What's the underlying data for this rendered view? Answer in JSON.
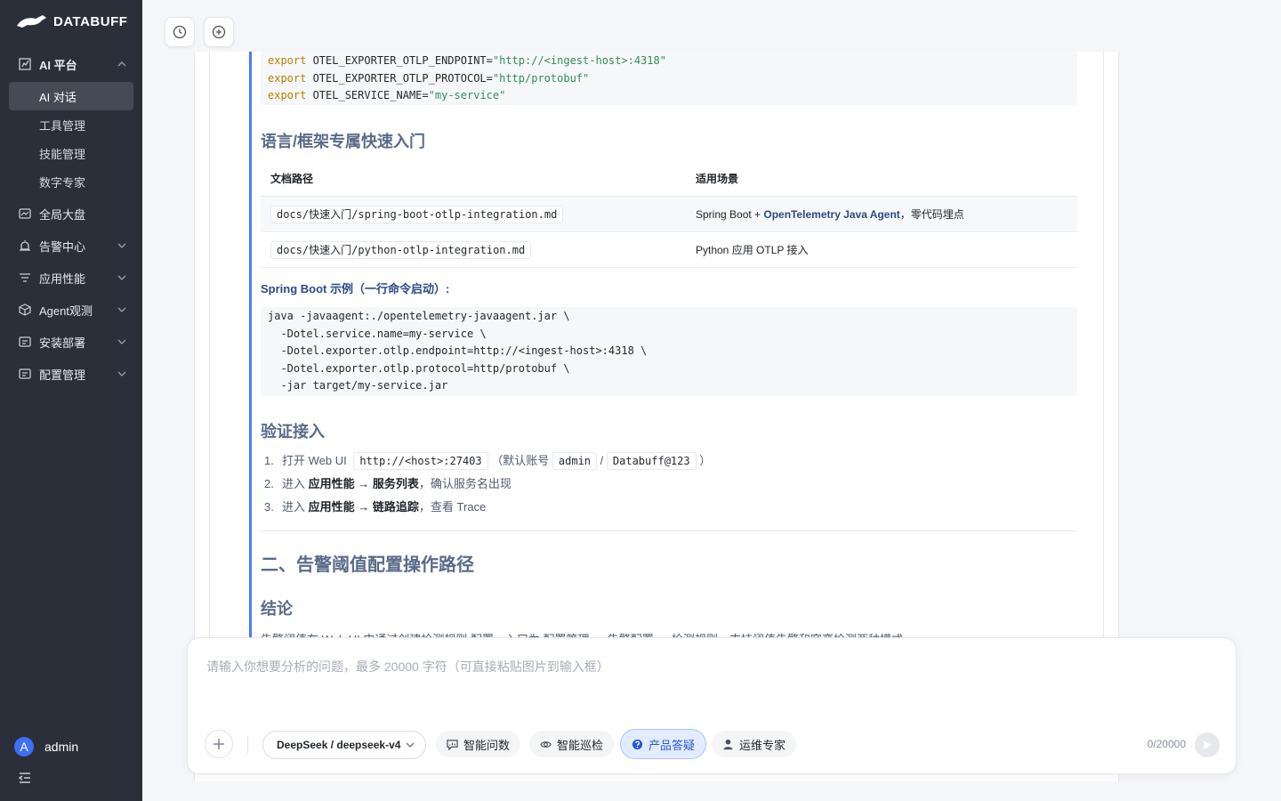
{
  "brand": {
    "name": "DATABUFF"
  },
  "sidebar": {
    "groups": [
      {
        "label": "AI 平台",
        "icon": "chart-icon",
        "expanded": true,
        "children": [
          {
            "label": "AI 对话",
            "active": true
          },
          {
            "label": "工具管理"
          },
          {
            "label": "技能管理"
          },
          {
            "label": "数字专家"
          }
        ]
      },
      {
        "label": "全局大盘",
        "icon": "dashboard-icon"
      },
      {
        "label": "告警中心",
        "icon": "alarm-icon"
      },
      {
        "label": "应用性能",
        "icon": "list-icon"
      },
      {
        "label": "Agent观测",
        "icon": "cube-icon"
      },
      {
        "label": "安装部署",
        "icon": "install-icon"
      },
      {
        "label": "配置管理",
        "icon": "config-icon"
      }
    ],
    "user": {
      "initial": "A",
      "name": "admin"
    }
  },
  "answer": {
    "env_code": [
      {
        "kw": "export",
        "key": " OTEL_EXPORTER_OTLP_ENDPOINT=",
        "val": "\"http://<ingest-host>:4318\""
      },
      {
        "kw": "export",
        "key": " OTEL_EXPORTER_OTLP_PROTOCOL=",
        "val": "\"http/protobuf\""
      },
      {
        "kw": "export",
        "key": " OTEL_SERVICE_NAME=",
        "val": "\"my-service\""
      }
    ],
    "section_lang": "语言/框架专属快速入门",
    "table": {
      "headers": [
        "文档路径",
        "适用场景"
      ],
      "rows": [
        {
          "path": "docs/快速入门/spring-boot-otlp-integration.md",
          "scene_pre": "Spring Boot + ",
          "scene_bold": "OpenTelemetry Java Agent",
          "scene_post": "，零代码埋点"
        },
        {
          "path": "docs/快速入门/python-otlp-integration.md",
          "scene_pre": "Python 应用 OTLP 接入",
          "scene_bold": "",
          "scene_post": ""
        }
      ]
    },
    "springboot_label": "Spring Boot 示例（一行命令启动）:",
    "java_code": "java -javaagent:./opentelemetry-javaagent.jar \\\n  -Dotel.service.name=my-service \\\n  -Dotel.exporter.otlp.endpoint=http://<ingest-host>:4318 \\\n  -Dotel.exporter.otlp.protocol=http/protobuf \\\n  -jar target/my-service.jar",
    "section_verify": "验证接入",
    "steps": {
      "s1_pre": "打开 Web UI",
      "s1_url": "http://<host>:27403",
      "s1_mid": "（默认账号",
      "s1_user": "admin",
      "s1_slash": "/",
      "s1_pwd": "Databuff@123",
      "s1_end": "）",
      "s2_pre": "进入",
      "s2_a": "应用性能",
      "s2_arrow": "→",
      "s2_b": "服务列表",
      "s2_post": "，确认服务名出现",
      "s3_pre": "进入",
      "s3_a": "应用性能",
      "s3_arrow": "→",
      "s3_b": "链路追踪",
      "s3_post": "，查看 Trace"
    },
    "section_alarm": "二、告警阈值配置操作路径",
    "section_conclusion": "结论",
    "cut_line": "告警阈值在 Web UI 中通过创建检测规则 配置，入口为 配置管理 → 告警配置 → 检测规则，支持阈值告警和突变检测两种模式"
  },
  "input": {
    "placeholder": "请输入你想要分析的问题，最多 20000 字符（可直接粘贴图片到输入框）",
    "model": "DeepSeek / deepseek-v4",
    "modes": [
      {
        "label": "智能问数",
        "icon": "chat-data-icon",
        "active": false
      },
      {
        "label": "智能巡检",
        "icon": "eye-icon",
        "active": false
      },
      {
        "label": "产品答疑",
        "icon": "question-icon",
        "active": true
      },
      {
        "label": "运维专家",
        "icon": "person-icon",
        "active": false
      }
    ],
    "counter": "0/20000"
  },
  "colors": {
    "accent": "#4c7cf6",
    "sidebar_bg": "#2b2f3a",
    "active_pill": "#e3ecfe"
  }
}
